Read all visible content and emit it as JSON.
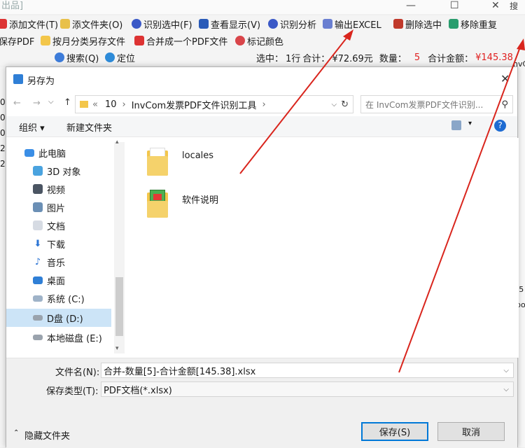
{
  "app": {
    "title": "出品]",
    "toolbar1": [
      "添加文件(T)",
      "添文件夹(O)",
      "识别选中(F)",
      "查看显示(V)",
      "识别分析",
      "输出EXCEL",
      "删除选中",
      "移除重复"
    ],
    "toolbar2": [
      "保存PDF",
      "按月分类另存文件",
      "合并成一个PDF文件",
      "标记颜色"
    ],
    "search_label": "搜索(Q)",
    "locate_label": "定位",
    "status": {
      "sel_label": "选中：",
      "sel_rows": "1行",
      "sum_label": "合计：",
      "sum_value": "¥72.69元",
      "qty_label": "数量：",
      "qty_value": "5",
      "total_label": "合计金额：",
      "total_value": "¥145.38"
    },
    "right_search": "搜",
    "right_frag": "nvCo",
    "left_nums": [
      "0",
      "0",
      "0",
      "2",
      "2"
    ],
    "right_frag2": "[5",
    "right_frag3": "po"
  },
  "dialog": {
    "title": "另存为",
    "path": [
      "10",
      "InvCom发票PDF文件识别工具"
    ],
    "path_prefix": "«",
    "search_placeholder": "在 InvCom发票PDF文件识别...",
    "organize": "组织",
    "new_folder": "新建文件夹",
    "nav": [
      "此电脑",
      "3D 对象",
      "视频",
      "图片",
      "文档",
      "下载",
      "音乐",
      "桌面",
      "系统 (C:)",
      "D盘 (D:)",
      "本地磁盘 (E:)"
    ],
    "items": [
      "locales",
      "软件说明"
    ],
    "filename_label": "文件名(N):",
    "filename_value": "合并-数量[5]-合计金额[145.38].xlsx",
    "filetype_label": "保存类型(T):",
    "filetype_value": "PDF文档(*.xlsx)",
    "hide_folders": "隐藏文件夹",
    "save": "保存(S)",
    "cancel": "取消"
  },
  "colors": {
    "accent": "#0078d7",
    "arrow": "#d9251d",
    "price": "#e02020",
    "folder": "#f3c64a"
  }
}
